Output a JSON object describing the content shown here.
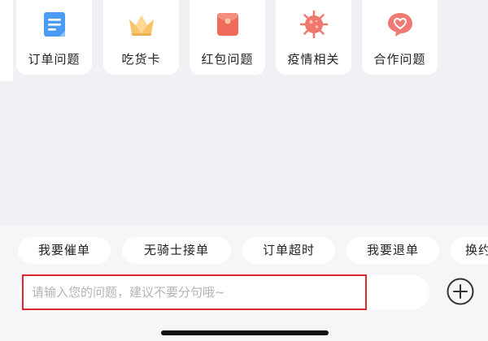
{
  "categories": [
    {
      "label": "订单问题",
      "icon": "document-icon"
    },
    {
      "label": "吃货卡",
      "icon": "crown-icon"
    },
    {
      "label": "红包问题",
      "icon": "red-envelope-icon"
    },
    {
      "label": "疫情相关",
      "icon": "virus-icon"
    },
    {
      "label": "合作问题",
      "icon": "heart-chat-icon"
    }
  ],
  "quick_replies": [
    "我要催单",
    "无骑士接单",
    "订单超时",
    "我要退单",
    "换约"
  ],
  "input": {
    "placeholder": "请输入您的问题，建议不要分句哦~",
    "value": ""
  },
  "colors": {
    "accent_blue": "#4a9cf5",
    "crown_yellow": "#f7c46b",
    "envelope_red": "#f06b5b",
    "virus_pink": "#f0776c",
    "chat_pink": "#f27a74",
    "highlight_red": "#e0282c"
  }
}
